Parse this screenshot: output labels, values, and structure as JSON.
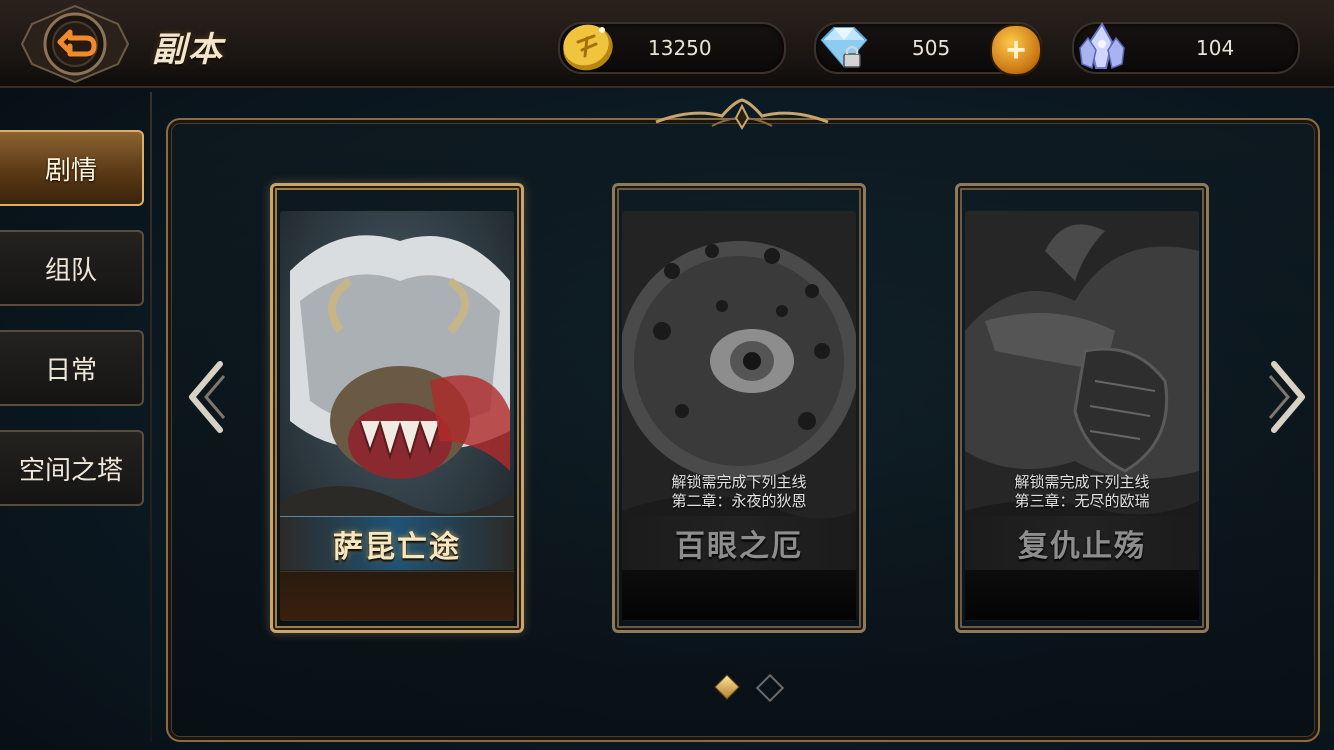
{
  "header": {
    "title": "副本",
    "back_icon": "back-arrow-icon"
  },
  "resources": {
    "gold": {
      "value": "13250",
      "icon": "gold-coin-icon"
    },
    "diamond": {
      "value": "505",
      "icon": "locked-diamond-icon",
      "plus_label": "+"
    },
    "crystal": {
      "value": "104",
      "icon": "crystal-icon"
    }
  },
  "sidebar": {
    "items": [
      {
        "label": "剧情",
        "active": true
      },
      {
        "label": "组队",
        "active": false
      },
      {
        "label": "日常",
        "active": false
      },
      {
        "label": "空间之塔",
        "active": false
      }
    ]
  },
  "cards": [
    {
      "name": "萨昆亡途",
      "locked": false,
      "lock_line1": "",
      "lock_line2": ""
    },
    {
      "name": "百眼之厄",
      "locked": true,
      "lock_line1": "解锁需完成下列主线",
      "lock_line2": "第二章：永夜的狄恩"
    },
    {
      "name": "复仇止殇",
      "locked": true,
      "lock_line1": "解锁需完成下列主线",
      "lock_line2": "第三章：无尽的欧瑞"
    }
  ],
  "pagination": {
    "current": 1,
    "total": 2
  },
  "colors": {
    "accent_gold": "#c9a56a",
    "panel_border": "#8a6c42"
  }
}
